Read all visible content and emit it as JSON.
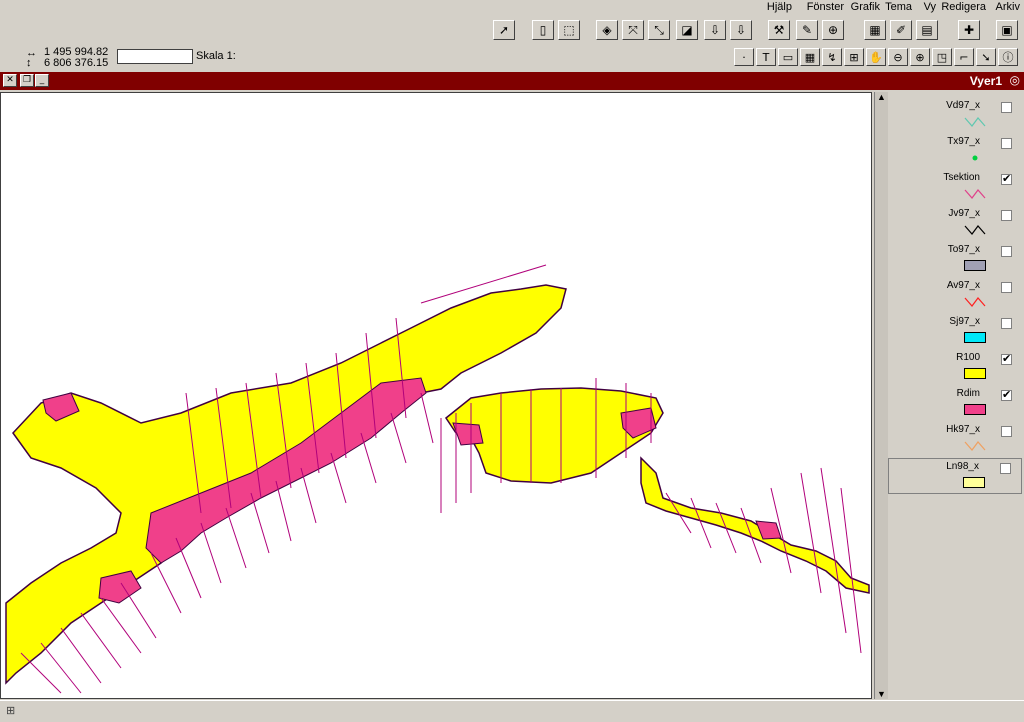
{
  "menu": {
    "items": [
      "Arkiv",
      "Redigera",
      "Vy",
      "Tema",
      "Grafik",
      "Fönster",
      "Hjälp"
    ]
  },
  "coords": {
    "x": "1 495 994.82",
    "y": "6 806 376.15"
  },
  "scale": {
    "label": "Skala 1:",
    "value": ""
  },
  "window": {
    "title": "Vyer1"
  },
  "legend": {
    "items": [
      {
        "label": "Vd97_x",
        "checked": false,
        "swatch": "line",
        "color": "#5fc8b0"
      },
      {
        "label": "Tx97_x",
        "checked": false,
        "swatch": "dot",
        "color": "#00d040"
      },
      {
        "label": "Tsektion",
        "checked": true,
        "swatch": "line",
        "color": "#e0408a"
      },
      {
        "label": "Jv97_x",
        "checked": false,
        "swatch": "line",
        "color": "#000000"
      },
      {
        "label": "To97_x",
        "checked": false,
        "swatch": "fill",
        "color": "#a0a0b4"
      },
      {
        "label": "Av97_x",
        "checked": false,
        "swatch": "line",
        "color": "#ff2020"
      },
      {
        "label": "Sj97_x",
        "checked": false,
        "swatch": "fill",
        "color": "#00e8f8"
      },
      {
        "label": "R100",
        "checked": true,
        "swatch": "fill",
        "color": "#ffff00"
      },
      {
        "label": "Rdim",
        "checked": true,
        "swatch": "fill",
        "color": "#f0408a"
      },
      {
        "label": "Hk97_x",
        "checked": false,
        "swatch": "line",
        "color": "#f0a060"
      },
      {
        "label": "Ln98_x",
        "checked": false,
        "swatch": "fill",
        "color": "#ffff99"
      }
    ]
  },
  "colors": {
    "titlebar": "#800000",
    "r100": "#ffff00",
    "rdim": "#f0408a",
    "tsektion": "#b0007a"
  }
}
